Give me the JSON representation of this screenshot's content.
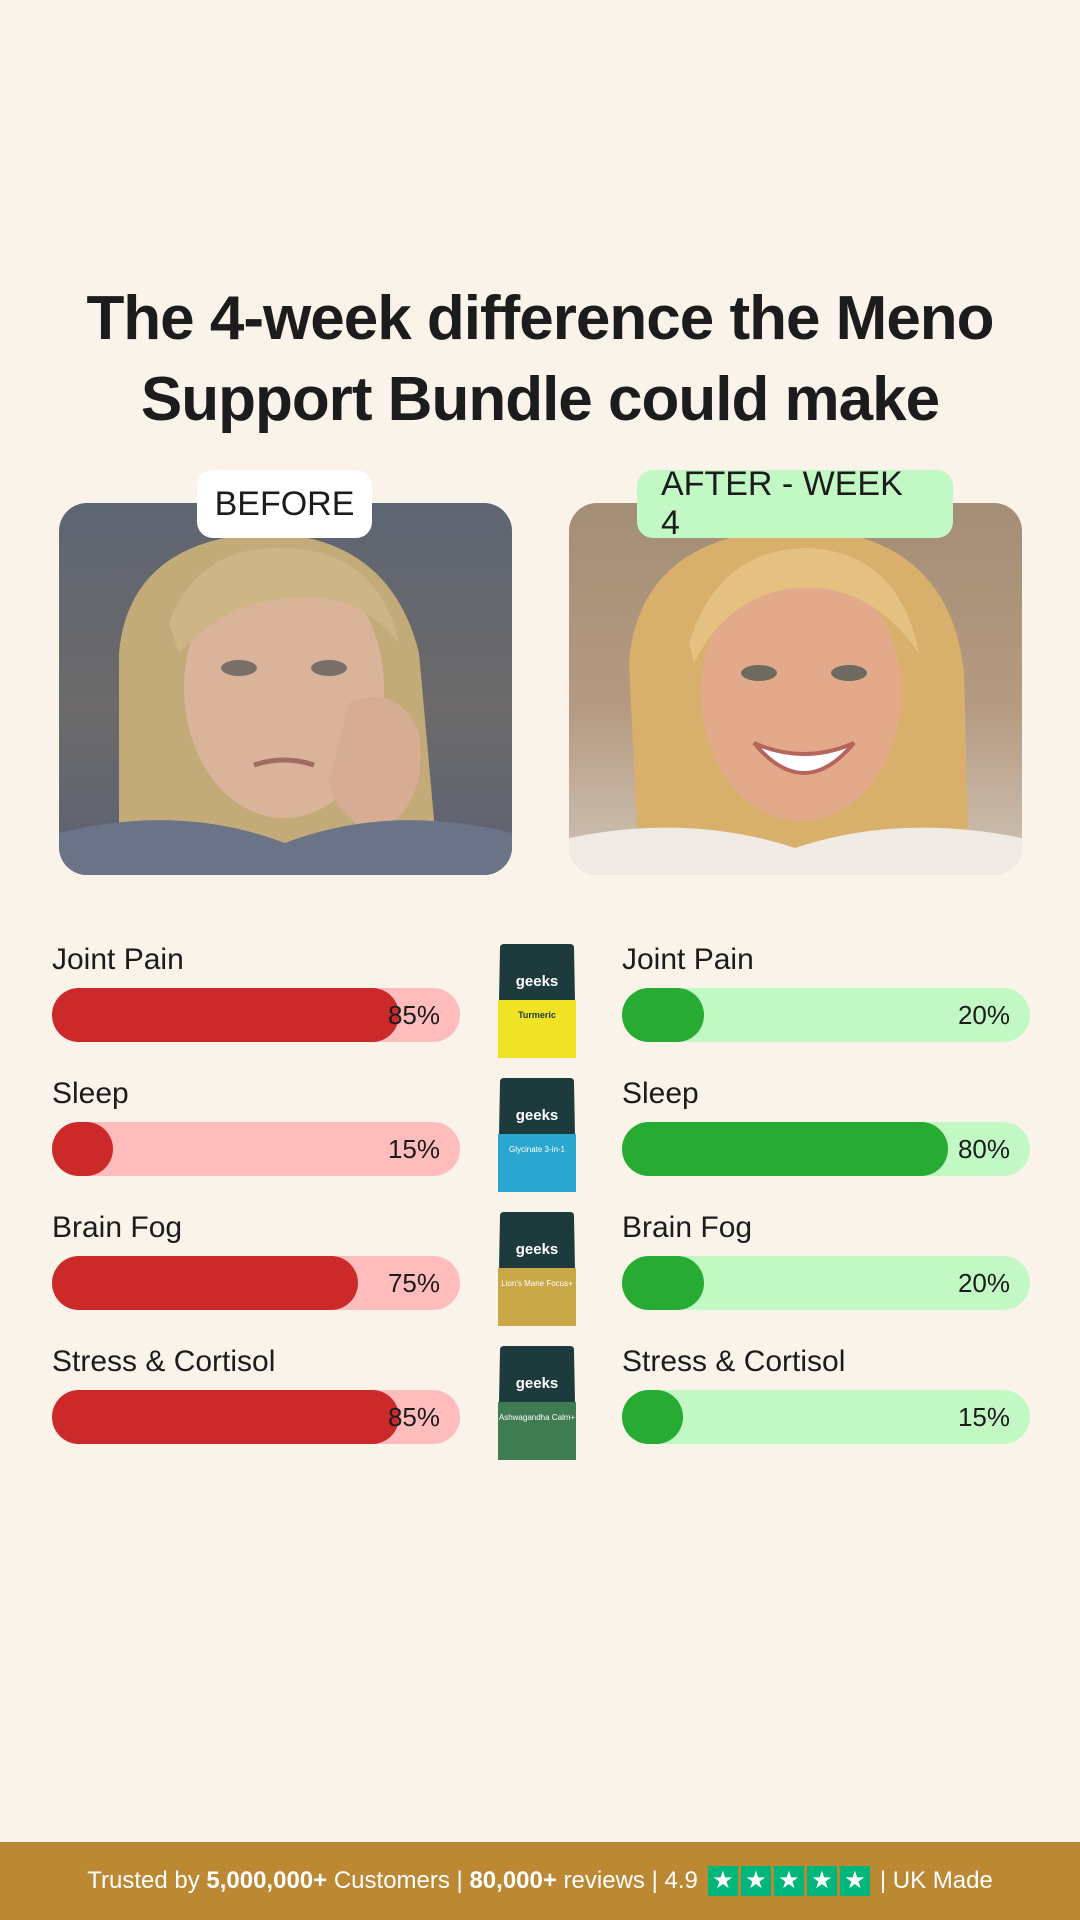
{
  "headline": "The 4-week difference the Meno Support Bundle could make",
  "before": {
    "tag": "BEFORE",
    "photo_alt": "woman looking tired"
  },
  "after": {
    "tag": "AFTER - WEEK 4",
    "photo_alt": "woman smiling"
  },
  "metrics": {
    "before": [
      {
        "label": "Joint Pain",
        "value": 85,
        "display": "85%"
      },
      {
        "label": "Sleep",
        "value": 15,
        "display": "15%"
      },
      {
        "label": "Brain Fog",
        "value": 75,
        "display": "75%"
      },
      {
        "label": "Stress & Cortisol",
        "value": 85,
        "display": "85%"
      }
    ],
    "after": [
      {
        "label": "Joint Pain",
        "value": 20,
        "display": "20%"
      },
      {
        "label": "Sleep",
        "value": 80,
        "display": "80%"
      },
      {
        "label": "Brain Fog",
        "value": 20,
        "display": "20%"
      },
      {
        "label": "Stress & Cortisol",
        "value": 15,
        "display": "15%"
      }
    ]
  },
  "products": [
    {
      "brand": "nutrition geeks",
      "name": "Turmeric",
      "color": "#f0e224"
    },
    {
      "brand": "nutrition geeks",
      "name": "Glycinate 3-in-1",
      "color": "#2aa6cf"
    },
    {
      "brand": "nutrition geeks",
      "name": "Lion's Mane Focus+",
      "color": "#c9a847"
    },
    {
      "brand": "nutrition geeks",
      "name": "Ashwagandha Calm+",
      "color": "#3f7c52"
    }
  ],
  "footer": {
    "pre": "Trusted by",
    "customers_count": "5,000,000+",
    "customers_label": "Customers |",
    "reviews_count": "80,000+",
    "reviews_label": "reviews | 4.9",
    "rating": 4.9,
    "star_glyph": "★",
    "star_color": "#00b67a",
    "post": "| UK Made"
  },
  "colors": {
    "background": "#f9f3ea",
    "bad_fill": "#cc2a2a",
    "bad_track": "#ffbcbc",
    "good_fill": "#28ab32",
    "good_track": "#c1f8c4",
    "footer_bg": "#bb8833"
  }
}
